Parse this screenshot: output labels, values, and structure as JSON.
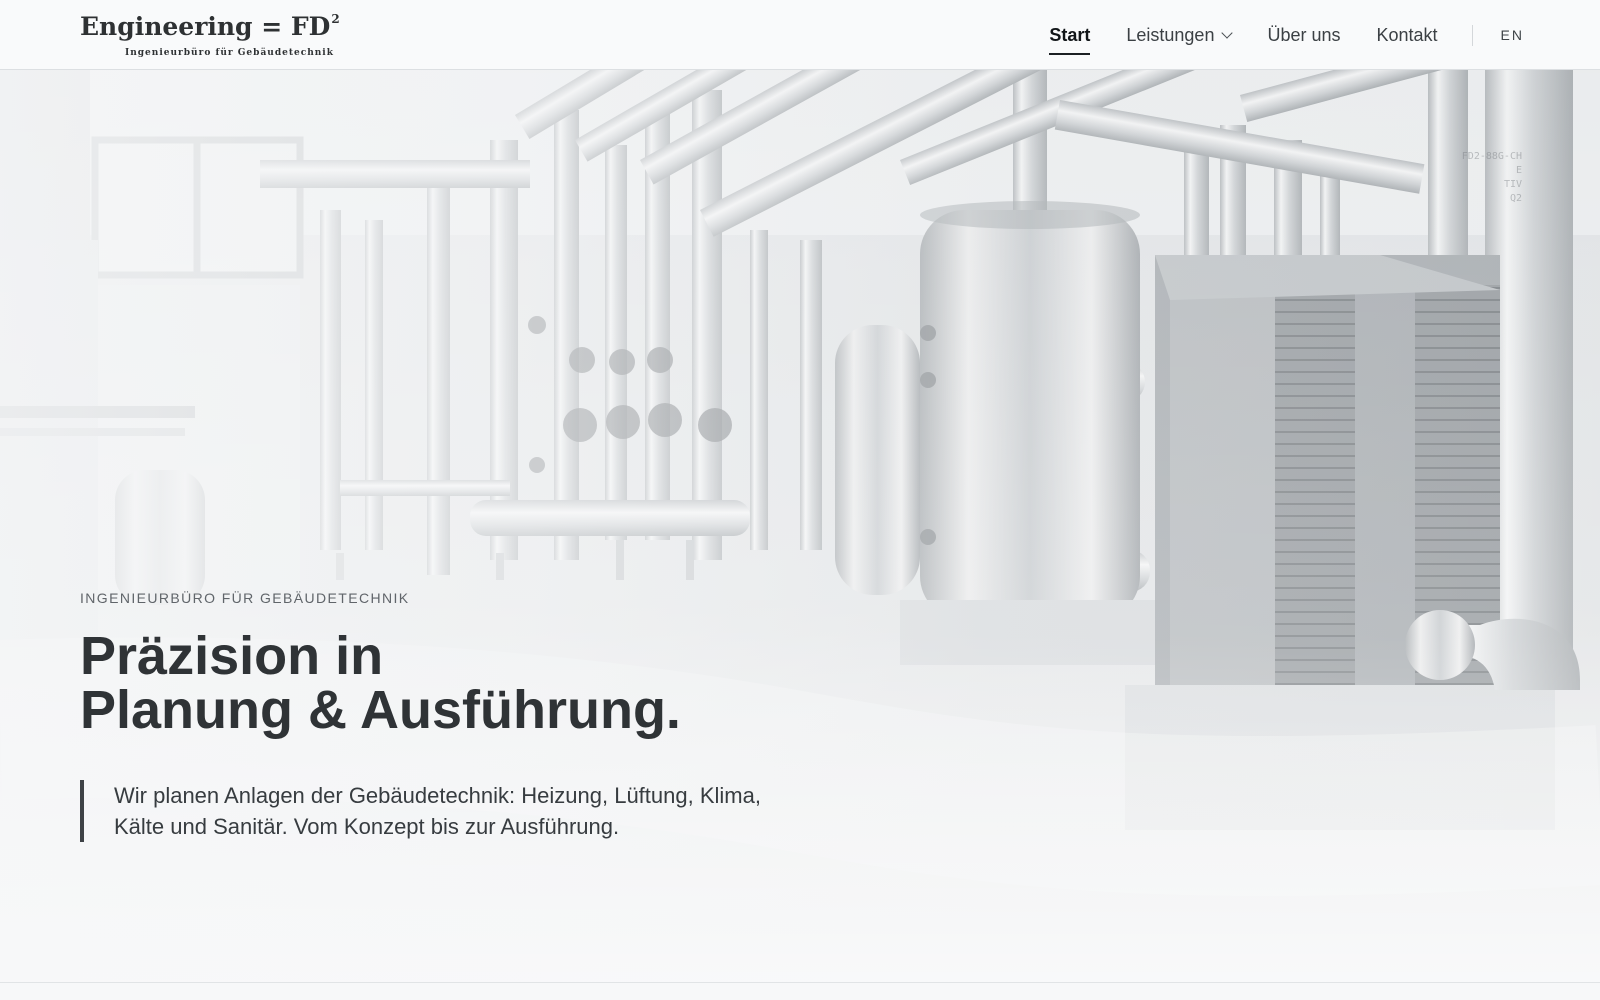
{
  "brand": {
    "name": "Engineering = FD",
    "superscript": "2",
    "subtitle": "Ingenieurbüro für Gebäudetechnik"
  },
  "navigation": {
    "items": [
      {
        "label": "Start",
        "active": true
      },
      {
        "label": "Leistungen",
        "icon": "chevron-down-icon"
      },
      {
        "label": "Über uns"
      },
      {
        "label": "Kontakt"
      }
    ],
    "language": "EN"
  },
  "hero": {
    "eyebrow": "INGENIEURBÜRO FÜR GEBÄUDETECHNIK",
    "title_line_1": "Präzision in",
    "title_line_2": "Planung & Ausführung.",
    "description_line_1": "Wir planen Anlagen der Gebäudetechnik: Heizung, Lüftung, Klima,",
    "description_line_2": "Kälte und Sanitär. Vom Konzept bis zur Ausführung."
  },
  "equipment_tags": [
    "FD2-88G-CH",
    "E",
    "TIV",
    "Q2"
  ],
  "colors": {
    "text": "#2f3337",
    "accent": "#3e4246",
    "header": "#f9fafb"
  }
}
